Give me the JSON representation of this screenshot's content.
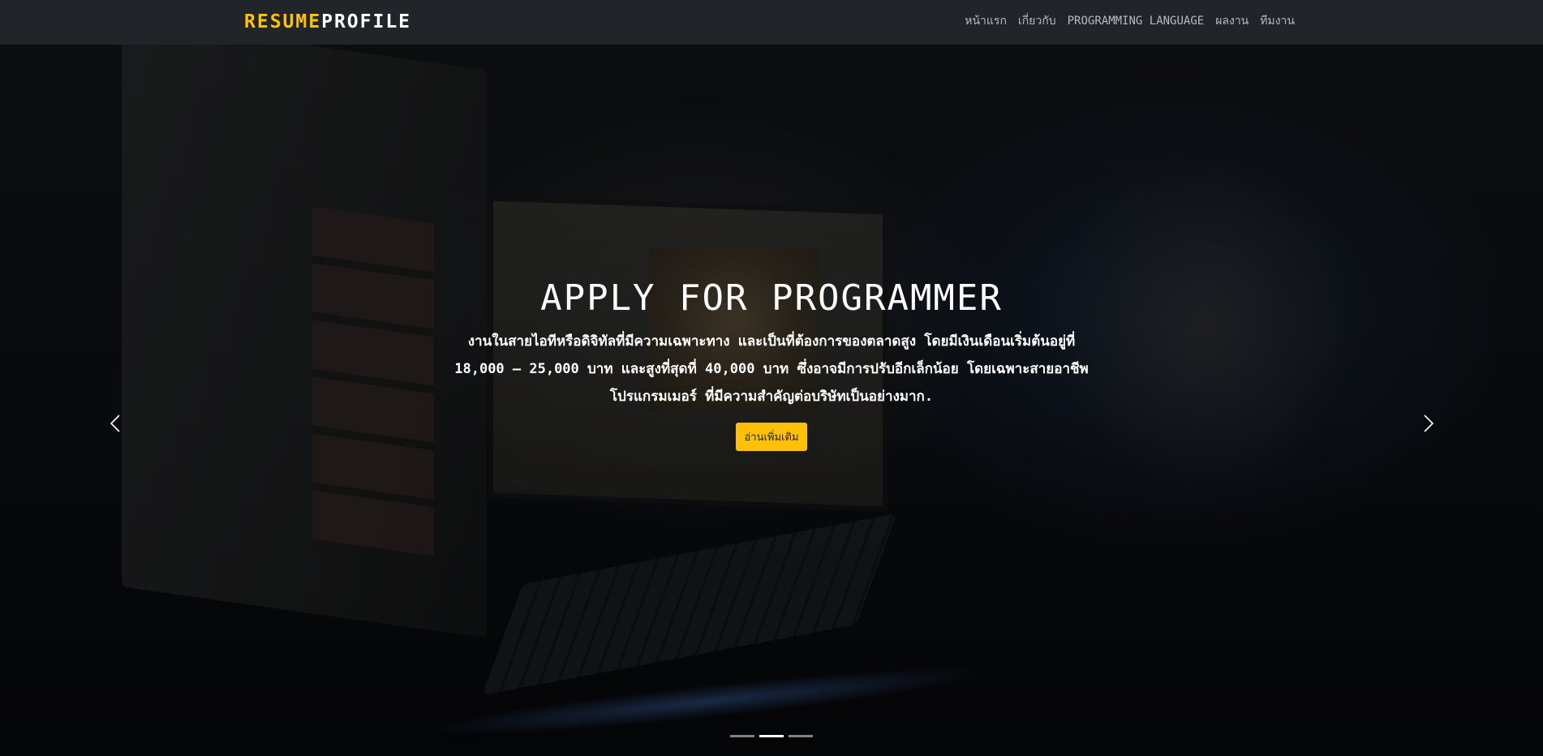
{
  "navbar": {
    "brand_part1": "RESUME",
    "brand_part2": "PROFILE",
    "links": [
      {
        "label": "หน้าแรก"
      },
      {
        "label": "เกี่ยวกับ"
      },
      {
        "label": "PROGRAMMING LANGUAGE"
      },
      {
        "label": "ผลงาน"
      },
      {
        "label": "ทีมงาน"
      }
    ]
  },
  "hero": {
    "title": "APPLY FOR PROGRAMMER",
    "text": "งานในสายไอทีหรือดิจิทัลที่มีความเฉพาะทาง และเป็นที่ต้องการของตลาดสูง โดยมีเงินเดือนเริ่มต้นอยู่ที่ 18,000 – 25,000 บาท และสูงที่สุดที่ 40,000 บาท ซึ่งอาจมีการปรับอีกเล็กน้อย โดยเฉพาะสายอาชีพโปรแกรมเมอร์ ที่มีความสำคัญต่อบริษัทเป็นอย่างมาก.",
    "button_label": "อ่านเพิ่มเติม",
    "prev_icon": "chevron-left-icon",
    "next_icon": "chevron-right-icon",
    "slide_count": 3,
    "active_slide": 2
  },
  "colors": {
    "accent": "#ffc107",
    "navbar_bg": "#212529",
    "nav_link": "#b7babd"
  }
}
